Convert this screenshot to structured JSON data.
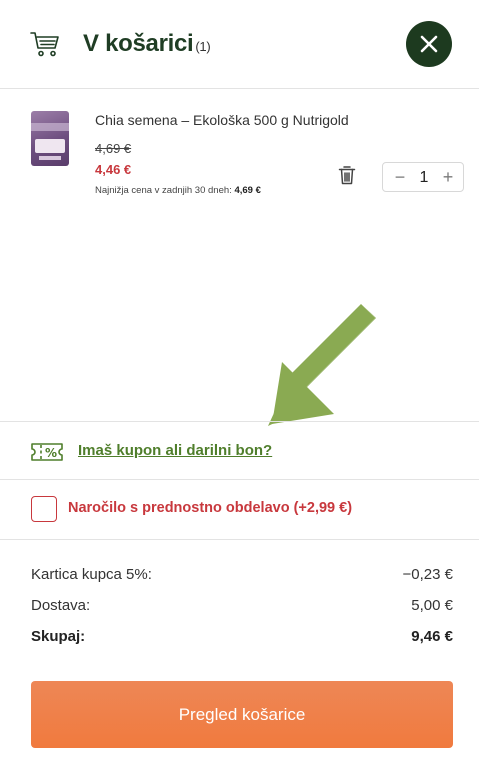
{
  "header": {
    "title": "V košarici",
    "count": "(1)",
    "cart_icon": "shopping-cart-icon",
    "close_icon": "close-icon",
    "accent_color": "#1d3a1f"
  },
  "product": {
    "name": "Chia semena – Ekološka 500 g Nutrigold",
    "old_price": "4,69 €",
    "new_price": "4,46 €",
    "lowest_label": "Najnižja cena v zadnjih 30 dneh: ",
    "lowest_value": "4,69 €",
    "quantity": "1",
    "minus_symbol": "−",
    "plus_symbol": "+",
    "trash_icon": "trash-icon"
  },
  "coupon": {
    "label": "Imaš kupon ali darilni bon?",
    "icon": "coupon-ticket-icon"
  },
  "priority": {
    "label": "Naročilo s prednostno obdelavo (+2,99 €)",
    "checked": false
  },
  "summary": {
    "rows": [
      {
        "label": "Kartica kupca  5%:",
        "amount": "−0,23 €"
      },
      {
        "label": "Dostava:",
        "amount": "5,00 €"
      },
      {
        "label": "Skupaj:",
        "amount": "9,46 €"
      }
    ]
  },
  "cta": {
    "label": "Pregled košarice",
    "color": "#f07a3e"
  },
  "colors": {
    "price_red": "#c8383d",
    "link_green": "#4f7e2b",
    "arrow_green": "#8aaa52"
  }
}
